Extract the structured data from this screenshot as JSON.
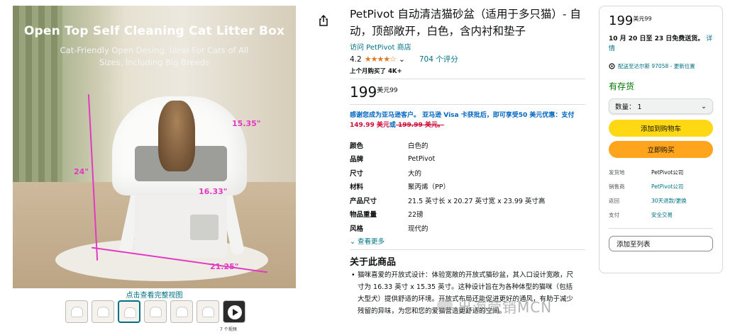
{
  "gallery": {
    "image_title": "Open Top Self Cleaning Cat Litter Box",
    "image_subtitle": "Cat-Friendly Open Desing, Ideal For Cats of All Sizes, Including Big Breeds",
    "dimensions": {
      "height": "24\"",
      "width": "16.33\"",
      "depth": "21.25\"",
      "side": "15.35\""
    },
    "view_full_link": "点击查看完整视图",
    "thumbnail_count": 7,
    "video_count_label": "7 个视频"
  },
  "product": {
    "title": "PetPivot 自动清洁猫砂盆（适用于多只猫）- 自动，顶部敞开，白色，含内衬和垫子",
    "store_link": "访问 PetPivot 商店",
    "rating_value": "4.2",
    "rating_stars": "★★★★☆",
    "ratings_count": "704 个评分",
    "bought_last_month": "上个月购买了 4K+",
    "price_whole": "199",
    "price_fraction": "美元99",
    "promo_line1": "感谢您成为亚马逊客户。 亚马逊 Visa 卡获批后，即可享受50 美元优惠：支付",
    "promo_new_price": "149.99 美元",
    "promo_or": "或",
    "promo_old_price": " 199.99 美元。",
    "specs": [
      {
        "key": "颜色",
        "value": "白色的"
      },
      {
        "key": "品牌",
        "value": "PetPivot"
      },
      {
        "key": "尺寸",
        "value": "大的"
      },
      {
        "key": "材料",
        "value": "聚丙烯（PP）"
      },
      {
        "key": "产品尺寸",
        "value": "21.5 英寸长 x 20.27 英寸宽 x 23.99 英寸高"
      },
      {
        "key": "物品重量",
        "value": "22磅"
      },
      {
        "key": "风格",
        "value": "现代的"
      }
    ],
    "see_more": "查看更多",
    "about_title": "关于此商品",
    "about_bullet": "猫咪喜爱的开放式设计：体验宽敞的开放式猫砂盆，其入口设计宽敞，尺寸为 16.33 英寸 x 15.35 英寸。这种设计旨在为各种体型的猫咪（包括大型犬）提供舒适的环境。开放式布局还能促进更好的通风，有助于减少残留的异味，为您和您的爱猫营造更舒适的空间。"
  },
  "buybox": {
    "price_whole": "199",
    "price_fraction": "美元99",
    "delivery_dates": "10 月 20 日至 23 日免费送货。",
    "delivery_details": "详情",
    "deliver_to": "配送至达尔斯 97058 - 更新位置",
    "stock_status": "有存货",
    "quantity_label": "数量：",
    "quantity_value": "1",
    "add_to_cart": "添加到购物车",
    "buy_now": "立即购买",
    "meta": [
      {
        "key": "发货地",
        "value": "PetPivot公司",
        "link": false
      },
      {
        "key": "销售商",
        "value": "PetPivot公司",
        "link": true
      },
      {
        "key": "返回",
        "value": "30天退款/更换",
        "link": true
      },
      {
        "key": "支付",
        "value": "安全交易",
        "link": true
      }
    ],
    "add_to_list": "添加至列表"
  },
  "watermark": "出海营销MCN",
  "colors": {
    "link": "#007185",
    "cart": "#ffd814",
    "buy": "#ffa41c",
    "stock": "#007600",
    "dimension": "#e23ac2"
  }
}
